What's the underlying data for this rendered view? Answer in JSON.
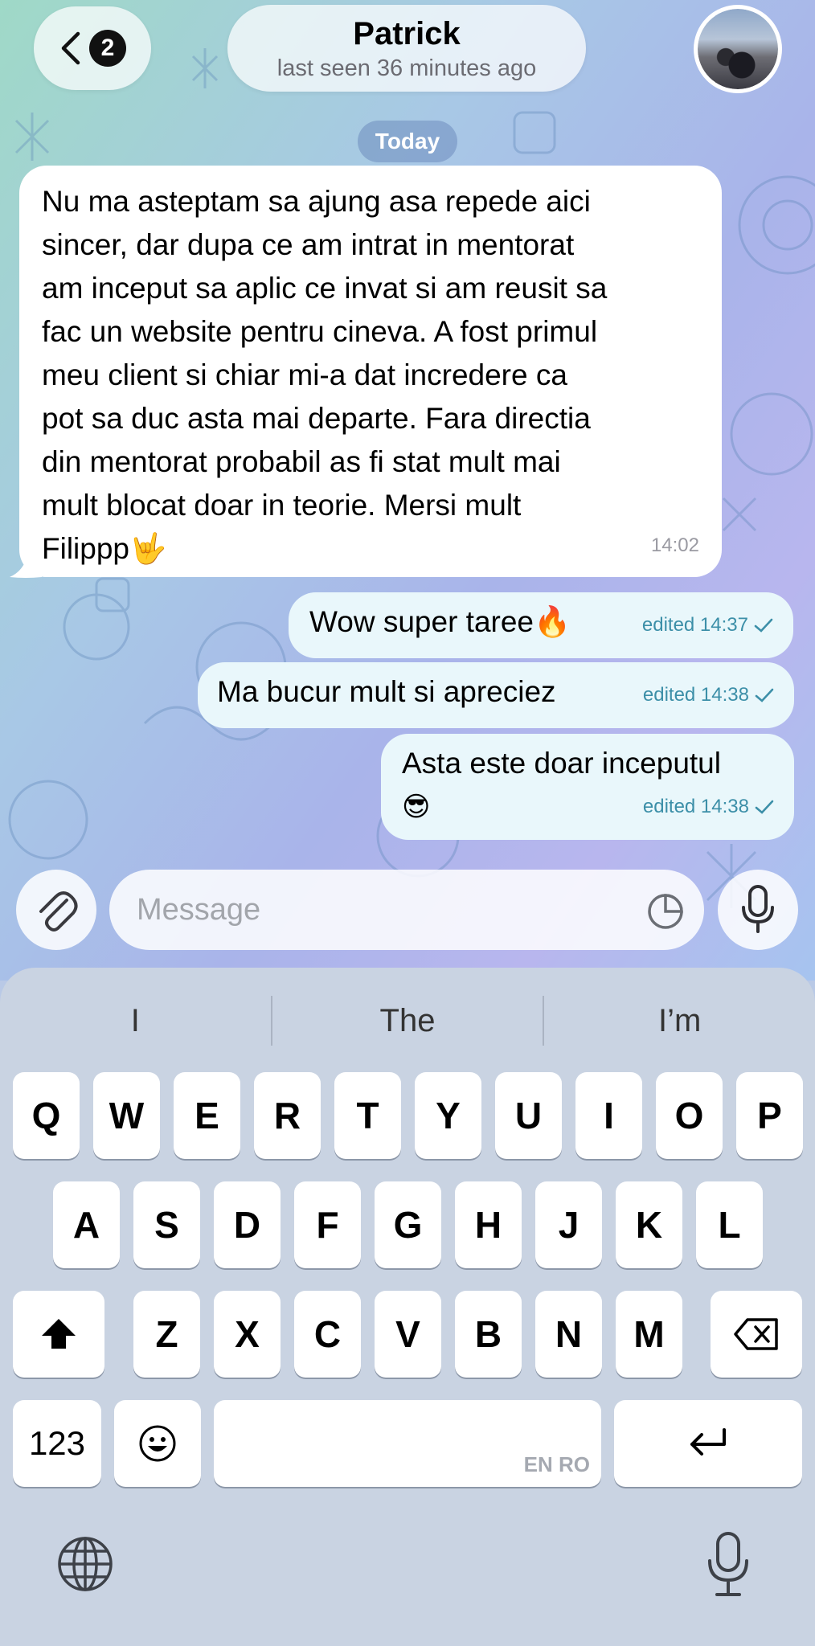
{
  "header": {
    "back_badge": "2",
    "contact_name": "Patrick",
    "contact_status": "last seen 36 minutes ago"
  },
  "date_divider": "Today",
  "messages": [
    {
      "direction": "incoming",
      "lines": [
        "Nu ma asteptam sa ajung asa repede aici",
        "sincer, dar dupa ce am intrat in mentorat",
        "am inceput sa aplic ce invat si am reusit sa",
        "fac un website pentru cineva. A fost primul",
        "meu client si chiar mi-a dat incredere ca",
        "pot sa duc asta mai departe. Fara directia",
        "din mentorat probabil as fi stat mult mai",
        "mult blocat doar in teorie. Mersi mult",
        "Filippp🤟"
      ],
      "time": "14:02"
    },
    {
      "direction": "outgoing",
      "text": "Wow super taree🔥",
      "meta": "edited 14:37"
    },
    {
      "direction": "outgoing",
      "text": "Ma bucur mult si apreciez",
      "meta": "edited 14:38"
    },
    {
      "direction": "outgoing",
      "text": "Asta este doar inceputul",
      "text2": "😎",
      "meta": "edited 14:38"
    }
  ],
  "composer": {
    "placeholder": "Message",
    "value": ""
  },
  "keyboard": {
    "suggestions": [
      "I",
      "The",
      "I’m"
    ],
    "row1": [
      "Q",
      "W",
      "E",
      "R",
      "T",
      "Y",
      "U",
      "I",
      "O",
      "P"
    ],
    "row2": [
      "A",
      "S",
      "D",
      "F",
      "G",
      "H",
      "J",
      "K",
      "L"
    ],
    "row3": [
      "Z",
      "X",
      "C",
      "V",
      "B",
      "N",
      "M"
    ],
    "numbers_label": "123",
    "space_lang": "EN RO"
  },
  "colors": {
    "outgoing_bubble": "#e9f7fb",
    "outgoing_meta": "#3c8fa8",
    "keyboard_bg": "#c9d3e2"
  },
  "icons": {
    "back": "chevron-left-icon",
    "attach": "paperclip-icon",
    "sticker": "sticker-icon",
    "mic": "microphone-icon",
    "shift": "shift-icon",
    "delete": "backspace-icon",
    "emoji": "emoji-icon",
    "return": "return-icon",
    "globe": "globe-icon",
    "dictation": "dictation-mic-icon"
  }
}
